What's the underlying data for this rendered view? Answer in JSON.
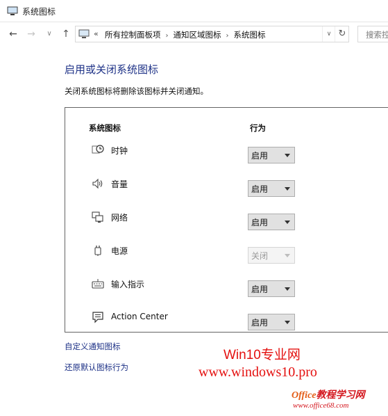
{
  "window": {
    "title": "系统图标",
    "icon": "monitor-icon"
  },
  "nav": {
    "back_icon": "back-arrow-icon",
    "forward_icon": "forward-arrow-icon",
    "recent_icon": "chevron-down-icon",
    "up_icon": "up-arrow-icon",
    "address": {
      "overflow": "«",
      "crumbs": [
        "所有控制面板项",
        "通知区域图标",
        "系统图标"
      ],
      "dropdown_icon": "chevron-down-icon",
      "refresh_icon": "refresh-icon"
    },
    "search_placeholder": "搜索控"
  },
  "main": {
    "heading": "启用或关闭系统图标",
    "description": "关闭系统图标将删除该图标并关闭通知。",
    "table": {
      "headers": [
        "系统图标",
        "行为"
      ],
      "rows": [
        {
          "icon": "clock-icon",
          "label": "时钟",
          "value": "启用",
          "enabled": true
        },
        {
          "icon": "volume-icon",
          "label": "音量",
          "value": "启用",
          "enabled": true
        },
        {
          "icon": "network-icon",
          "label": "网络",
          "value": "启用",
          "enabled": true
        },
        {
          "icon": "power-icon",
          "label": "电源",
          "value": "关闭",
          "enabled": false
        },
        {
          "icon": "keyboard-icon",
          "label": "输入指示",
          "value": "启用",
          "enabled": true
        },
        {
          "icon": "action-center-icon",
          "label": "Action Center",
          "value": "启用",
          "enabled": true
        }
      ]
    },
    "links": {
      "customize": "自定义通知图标",
      "restore": "还原默认图标行为"
    }
  },
  "watermarks": {
    "line1": "Win10专业网",
    "line2": "www.windows10.pro",
    "line3a": "Office",
    "line3b": "教程学习网",
    "line4": "www.office68.com"
  },
  "colors": {
    "link": "#1e3287",
    "watermark": "#e4100f"
  }
}
